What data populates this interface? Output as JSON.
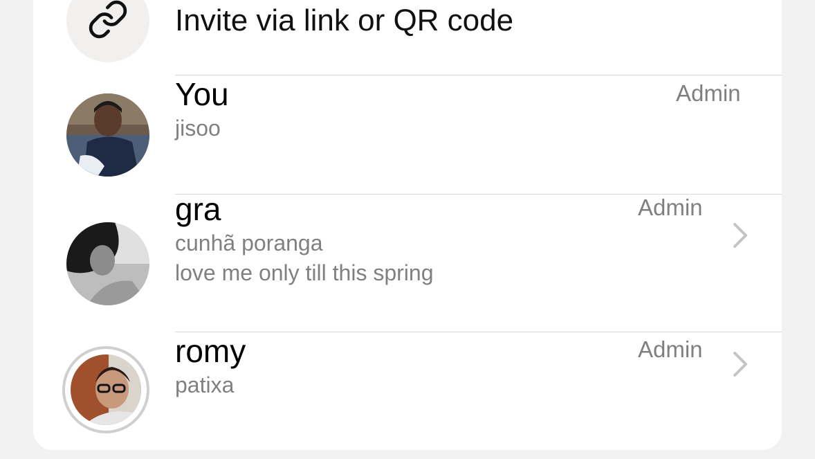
{
  "invite": {
    "label": "Invite via link or QR code",
    "icon": "link-icon"
  },
  "members": [
    {
      "name": "You",
      "subtitle": "jisoo",
      "role": "Admin",
      "chevron": false,
      "story_ring": false
    },
    {
      "name": "gra",
      "subtitle": "cunhã poranga",
      "subtitle2": "love me only till this spring",
      "role": "Admin",
      "chevron": true,
      "story_ring": false
    },
    {
      "name": "romy",
      "subtitle": "patixa",
      "role": "Admin",
      "chevron": true,
      "story_ring": true
    }
  ],
  "colors": {
    "background": "#f2f2f2",
    "card": "#ffffff",
    "secondary_text": "#808080",
    "divider": "#d9d9d9",
    "chevron": "#c4c4c4"
  }
}
